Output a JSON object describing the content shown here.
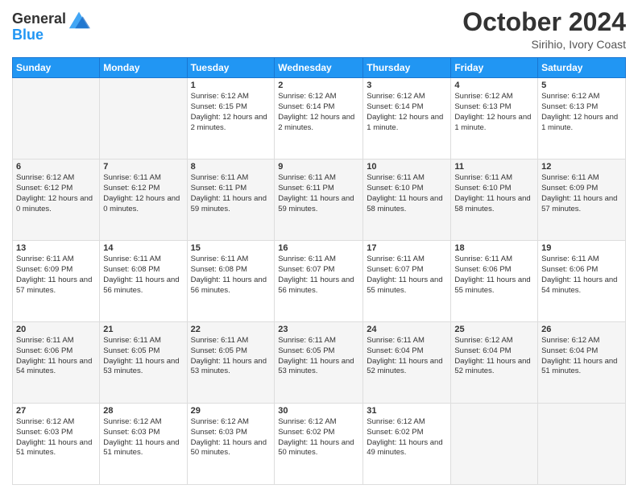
{
  "header": {
    "logo_line1": "General",
    "logo_line2": "Blue",
    "month": "October 2024",
    "location": "Sirihio, Ivory Coast"
  },
  "days_of_week": [
    "Sunday",
    "Monday",
    "Tuesday",
    "Wednesday",
    "Thursday",
    "Friday",
    "Saturday"
  ],
  "weeks": [
    [
      {
        "day": "",
        "info": ""
      },
      {
        "day": "",
        "info": ""
      },
      {
        "day": "1",
        "info": "Sunrise: 6:12 AM\nSunset: 6:15 PM\nDaylight: 12 hours and 2 minutes."
      },
      {
        "day": "2",
        "info": "Sunrise: 6:12 AM\nSunset: 6:14 PM\nDaylight: 12 hours and 2 minutes."
      },
      {
        "day": "3",
        "info": "Sunrise: 6:12 AM\nSunset: 6:14 PM\nDaylight: 12 hours and 1 minute."
      },
      {
        "day": "4",
        "info": "Sunrise: 6:12 AM\nSunset: 6:13 PM\nDaylight: 12 hours and 1 minute."
      },
      {
        "day": "5",
        "info": "Sunrise: 6:12 AM\nSunset: 6:13 PM\nDaylight: 12 hours and 1 minute."
      }
    ],
    [
      {
        "day": "6",
        "info": "Sunrise: 6:12 AM\nSunset: 6:12 PM\nDaylight: 12 hours and 0 minutes."
      },
      {
        "day": "7",
        "info": "Sunrise: 6:11 AM\nSunset: 6:12 PM\nDaylight: 12 hours and 0 minutes."
      },
      {
        "day": "8",
        "info": "Sunrise: 6:11 AM\nSunset: 6:11 PM\nDaylight: 11 hours and 59 minutes."
      },
      {
        "day": "9",
        "info": "Sunrise: 6:11 AM\nSunset: 6:11 PM\nDaylight: 11 hours and 59 minutes."
      },
      {
        "day": "10",
        "info": "Sunrise: 6:11 AM\nSunset: 6:10 PM\nDaylight: 11 hours and 58 minutes."
      },
      {
        "day": "11",
        "info": "Sunrise: 6:11 AM\nSunset: 6:10 PM\nDaylight: 11 hours and 58 minutes."
      },
      {
        "day": "12",
        "info": "Sunrise: 6:11 AM\nSunset: 6:09 PM\nDaylight: 11 hours and 57 minutes."
      }
    ],
    [
      {
        "day": "13",
        "info": "Sunrise: 6:11 AM\nSunset: 6:09 PM\nDaylight: 11 hours and 57 minutes."
      },
      {
        "day": "14",
        "info": "Sunrise: 6:11 AM\nSunset: 6:08 PM\nDaylight: 11 hours and 56 minutes."
      },
      {
        "day": "15",
        "info": "Sunrise: 6:11 AM\nSunset: 6:08 PM\nDaylight: 11 hours and 56 minutes."
      },
      {
        "day": "16",
        "info": "Sunrise: 6:11 AM\nSunset: 6:07 PM\nDaylight: 11 hours and 56 minutes."
      },
      {
        "day": "17",
        "info": "Sunrise: 6:11 AM\nSunset: 6:07 PM\nDaylight: 11 hours and 55 minutes."
      },
      {
        "day": "18",
        "info": "Sunrise: 6:11 AM\nSunset: 6:06 PM\nDaylight: 11 hours and 55 minutes."
      },
      {
        "day": "19",
        "info": "Sunrise: 6:11 AM\nSunset: 6:06 PM\nDaylight: 11 hours and 54 minutes."
      }
    ],
    [
      {
        "day": "20",
        "info": "Sunrise: 6:11 AM\nSunset: 6:06 PM\nDaylight: 11 hours and 54 minutes."
      },
      {
        "day": "21",
        "info": "Sunrise: 6:11 AM\nSunset: 6:05 PM\nDaylight: 11 hours and 53 minutes."
      },
      {
        "day": "22",
        "info": "Sunrise: 6:11 AM\nSunset: 6:05 PM\nDaylight: 11 hours and 53 minutes."
      },
      {
        "day": "23",
        "info": "Sunrise: 6:11 AM\nSunset: 6:05 PM\nDaylight: 11 hours and 53 minutes."
      },
      {
        "day": "24",
        "info": "Sunrise: 6:11 AM\nSunset: 6:04 PM\nDaylight: 11 hours and 52 minutes."
      },
      {
        "day": "25",
        "info": "Sunrise: 6:12 AM\nSunset: 6:04 PM\nDaylight: 11 hours and 52 minutes."
      },
      {
        "day": "26",
        "info": "Sunrise: 6:12 AM\nSunset: 6:04 PM\nDaylight: 11 hours and 51 minutes."
      }
    ],
    [
      {
        "day": "27",
        "info": "Sunrise: 6:12 AM\nSunset: 6:03 PM\nDaylight: 11 hours and 51 minutes."
      },
      {
        "day": "28",
        "info": "Sunrise: 6:12 AM\nSunset: 6:03 PM\nDaylight: 11 hours and 51 minutes."
      },
      {
        "day": "29",
        "info": "Sunrise: 6:12 AM\nSunset: 6:03 PM\nDaylight: 11 hours and 50 minutes."
      },
      {
        "day": "30",
        "info": "Sunrise: 6:12 AM\nSunset: 6:02 PM\nDaylight: 11 hours and 50 minutes."
      },
      {
        "day": "31",
        "info": "Sunrise: 6:12 AM\nSunset: 6:02 PM\nDaylight: 11 hours and 49 minutes."
      },
      {
        "day": "",
        "info": ""
      },
      {
        "day": "",
        "info": ""
      }
    ]
  ]
}
